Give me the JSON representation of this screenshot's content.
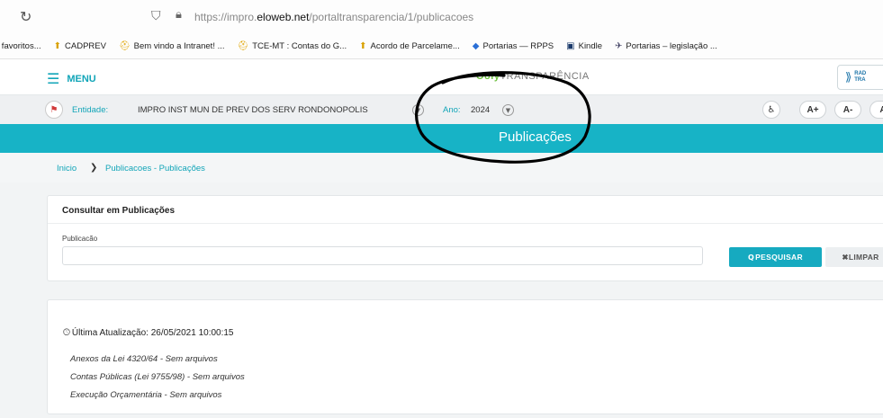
{
  "browser": {
    "url_prefix": "https://impro.",
    "url_domain": "eloweb.net",
    "url_path": "/portaltransparencia/1/publicacoes",
    "bookmarks": [
      {
        "icon": "folder-icon",
        "glyph": "",
        "label": "r favoritos..."
      },
      {
        "icon": "govbr-icon",
        "glyph": "⬆",
        "label": "CADPREV"
      },
      {
        "icon": "helmet-icon",
        "glyph": "⛑",
        "label": "Bem vindo a Intranet! ..."
      },
      {
        "icon": "helmet-icon",
        "glyph": "⛑",
        "label": "TCE-MT : Contas do G..."
      },
      {
        "icon": "govbr-icon",
        "glyph": "⬆",
        "label": "Acordo de Parcelame..."
      },
      {
        "icon": "diamond-icon",
        "glyph": "◆",
        "label": "Portarias — RPPS"
      },
      {
        "icon": "kindle-icon",
        "glyph": "▣",
        "label": "Kindle"
      },
      {
        "icon": "eagle-icon",
        "glyph": "✈",
        "label": "Portarias – legislação ..."
      }
    ]
  },
  "header": {
    "menu_label": "MENU",
    "brand_part1": "Ooly",
    "brand_part2": "TRANSPARÊNCIA",
    "badge_line1": "RAD",
    "badge_line2": "TRA"
  },
  "entity": {
    "entidade_label": "Entidade:",
    "entidade_value": "IMPRO INST MUN DE PREV DOS SERV RONDONOPOLIS",
    "ano_label": "Ano:",
    "ano_value": "2024",
    "font_plus": "A+",
    "font_minus": "A-",
    "font_extra": "A"
  },
  "banner": {
    "title": "Publicações"
  },
  "breadcrumb": {
    "home": "Inicio",
    "current": "Publicacoes - Publicações"
  },
  "search": {
    "title": "Consultar em Publicações",
    "field_label": "Publicacão",
    "field_value": "",
    "search_button": "PESQUISAR",
    "clear_button": "LIMPAR"
  },
  "results": {
    "last_update": "Última Atualização: 26/05/2021 10:00:15",
    "items": [
      "Anexos da Lei 4320/64 - Sem arquivos",
      "Contas Públicas (Lei 9755/98) - Sem arquivos",
      "Execução Orçamentária - Sem arquivos"
    ]
  },
  "colors": {
    "accent": "#17b3c6",
    "brand_green": "#6bbf3c",
    "annotation": "#000000"
  }
}
